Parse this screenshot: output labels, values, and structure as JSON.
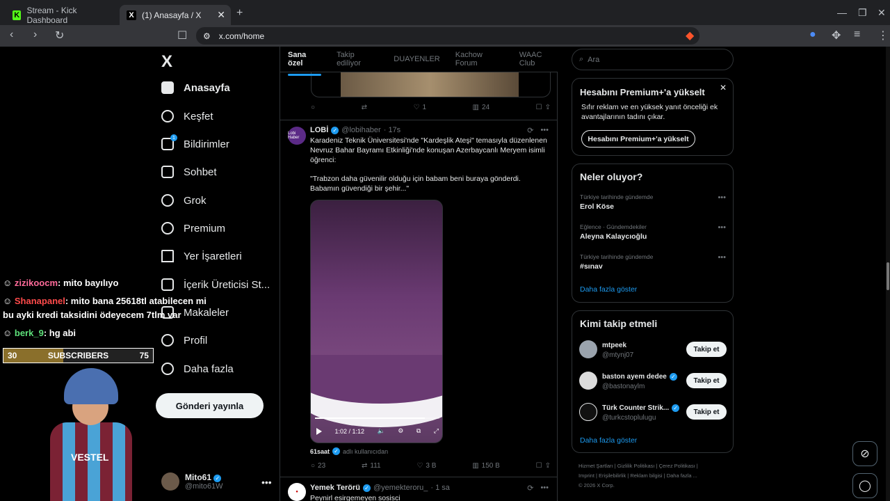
{
  "browser": {
    "tabs": [
      {
        "label": "Stream - Kick Dashboard",
        "icon": "K"
      },
      {
        "label": "(1) Anasayfa / X",
        "icon": "X"
      }
    ],
    "url": "x.com/home"
  },
  "nav": {
    "logo": "X",
    "items": [
      {
        "label": "Anasayfa",
        "icon": "home-icon"
      },
      {
        "label": "Keşfet",
        "icon": "search-icon"
      },
      {
        "label": "Bildirimler",
        "icon": "bell-icon",
        "badge": "1"
      },
      {
        "label": "Sohbet",
        "icon": "mail-icon"
      },
      {
        "label": "Grok",
        "icon": "grok-icon"
      },
      {
        "label": "Premium",
        "icon": "premium-icon"
      },
      {
        "label": "Yer İşaretleri",
        "icon": "bookmark-icon"
      },
      {
        "label": "İçerik Üreticisi St...",
        "icon": "rocket-icon"
      },
      {
        "label": "Makaleler",
        "icon": "article-icon"
      },
      {
        "label": "Profil",
        "icon": "person-icon"
      },
      {
        "label": "Daha fazla",
        "icon": "more-circle-icon"
      }
    ],
    "post_button": "Gönderi yayınla",
    "me": {
      "name": "Mito61",
      "handle": "@mito61W"
    }
  },
  "overlay": {
    "chat": [
      {
        "user": "zizikoocm",
        "msg": ": mito bayılıyo"
      },
      {
        "user": "Shanapanel",
        "msg": ": mito bana 25618tl atabilecen mi bu ayki kredi taksidini ödeyecem 7tlm var"
      },
      {
        "user": "berk_9",
        "msg": ": hg abi"
      }
    ],
    "subs": {
      "current": "30",
      "label": "SUBSCRIBERS",
      "goal": "75",
      "progress": 0.4
    },
    "shirt_text": "VESTEL"
  },
  "feed": {
    "tabs": [
      "Sana özel",
      "Takip ediliyor",
      "DUAYENLER",
      "Kachow Forum",
      "WAAC Club"
    ],
    "prev_actions": {
      "likes": "1",
      "views": "24"
    },
    "post": {
      "avatar_text": "Lobi Haber",
      "name": "LOBİ",
      "handle": "@lobihaber",
      "time": "· 17s",
      "text1": "Karadeniz Teknik Üniversitesi'nde \"Kardeşlik Ateşi\" temasıyla düzenlenen Nevruz Bahar Bayramı Etkinliği'nde konuşan Azerbaycanlı Meryem isimli öğrenci:",
      "text2": "\"Trabzon daha güvenilir olduğu için babam beni buraya gönderdi. Babamın güvendiği bir şehir...\"",
      "video_time": "1:02 / 1:12",
      "video_progress": 0.88,
      "credit_user": "61saat",
      "credit_text": "adlı kullanıcıdan",
      "replies": "23",
      "reposts": "111",
      "likes": "3 B",
      "views": "150 B"
    },
    "next_post": {
      "name": "Yemek Terörü",
      "handle": "@yemekteroru_",
      "time": "· 1 sa",
      "text": "Peynirl esirgemeyen sosisci"
    }
  },
  "right": {
    "search_placeholder": "Ara",
    "premium": {
      "title": "Hesabını Premium+'a yükselt",
      "text": "Sıfır reklam ve en yüksek yanıt önceliği ek avantajlarının tadını çıkar.",
      "button": "Hesabını Premium+'a yükselt"
    },
    "trends": {
      "title": "Neler oluyor?",
      "items": [
        {
          "category": "Türkiye tarihinde gündemde",
          "name": "Erol Köse"
        },
        {
          "category": "Eğlence · Gündemdekiler",
          "name": "Aleyna Kalaycıoğlu"
        },
        {
          "category": "Türkiye tarihinde gündemde",
          "name": "#sınav"
        }
      ],
      "show_more": "Daha fazla göster"
    },
    "who": {
      "title": "Kimi takip etmeli",
      "items": [
        {
          "name": "mtpeek",
          "handle": "@mtynj07",
          "verified": false
        },
        {
          "name": "baston ayem dedee",
          "handle": "@bastonaylm",
          "verified": true
        },
        {
          "name": "Türk Counter Strik...",
          "handle": "@turkcstoplulugu",
          "verified": true
        }
      ],
      "follow_label": "Takip et",
      "show_more": "Daha fazla göster"
    },
    "footer": {
      "line1": "Hizmet Şartları  |  Gizlilik Politikası  |  Çerez Politikası  |",
      "line2": "Imprint  |  Erişilebilirlik  |  Reklam bilgisi  |  Daha fazla ...",
      "line3": "© 2026 X Corp."
    }
  }
}
